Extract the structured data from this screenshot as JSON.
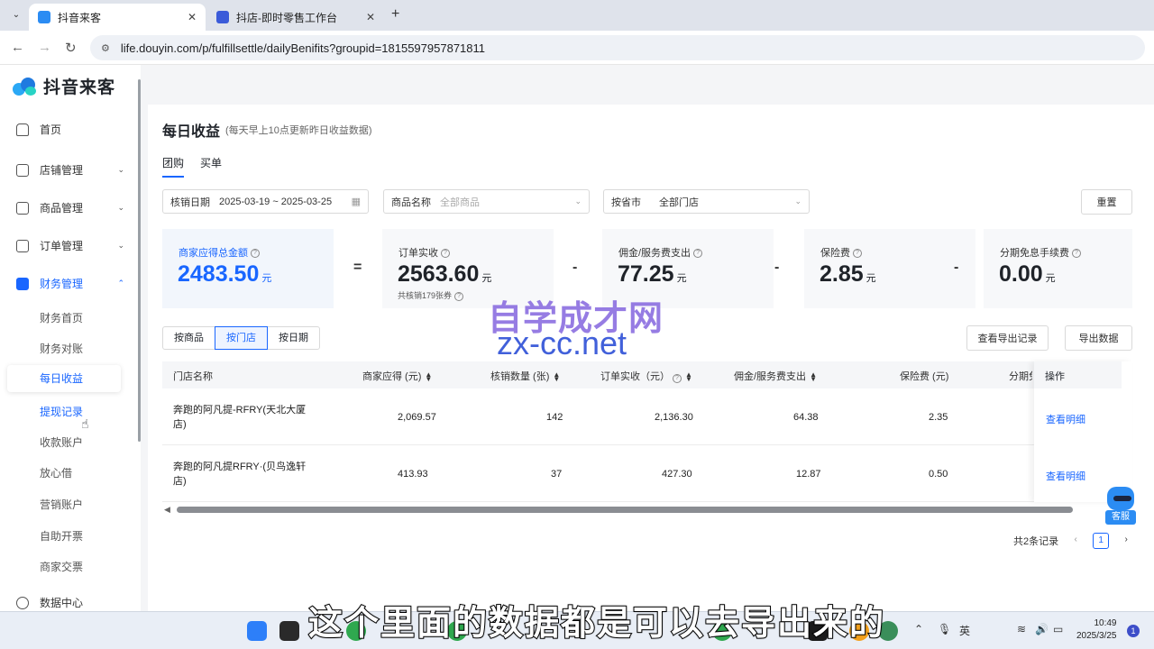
{
  "browser": {
    "tabs": [
      {
        "title": "抖音来客",
        "active": true
      },
      {
        "title": "抖店-即时零售工作台",
        "active": false
      }
    ],
    "url": "life.douyin.com/p/fulfillsettle/dailyBenifits?groupid=1815597957871811"
  },
  "sidebar": {
    "logo": "抖音来客",
    "items": [
      {
        "label": "首页"
      },
      {
        "label": "店铺管理"
      },
      {
        "label": "商品管理"
      },
      {
        "label": "订单管理"
      },
      {
        "label": "财务管理"
      },
      {
        "label": "数据中心"
      }
    ],
    "sub_items": [
      "财务首页",
      "财务对账",
      "每日收益",
      "提现记录",
      "收款账户",
      "放心借",
      "营销账户",
      "自助开票",
      "商家交票"
    ]
  },
  "page": {
    "title": "每日收益",
    "subtitle": "(每天早上10点更新昨日收益数据)",
    "tabs": [
      "团购",
      "买单"
    ],
    "filters": {
      "date_label": "核销日期",
      "date_value": "2025-03-19 ~ 2025-03-25",
      "product_label": "商品名称",
      "product_placeholder": "全部商品",
      "region_label": "按省市",
      "region_value": "全部门店"
    },
    "reset_button": "重置",
    "stats": [
      {
        "label": "商家应得总金额",
        "value": "2483.50",
        "unit": "元"
      },
      {
        "label": "订单实收",
        "value": "2563.60",
        "unit": "元",
        "note": "共核销179张券"
      },
      {
        "label": "佣金/服务费支出",
        "value": "77.25",
        "unit": "元"
      },
      {
        "label": "保险费",
        "value": "2.85",
        "unit": "元"
      },
      {
        "label": "分期免息手续费",
        "value": "0.00",
        "unit": "元"
      }
    ],
    "operators": [
      "=",
      "-",
      "-",
      "-"
    ],
    "segments": [
      "按商品",
      "按门店",
      "按日期"
    ],
    "export_log_button": "查看导出记录",
    "export_button": "导出数据",
    "table": {
      "headers": [
        "门店名称",
        "商家应得 (元)",
        "核销数量 (张)",
        "订单实收（元）",
        "佣金/服务费支出",
        "保险费 (元)",
        "分期免",
        "操作"
      ],
      "rows": [
        {
          "store": "奔跑的阿凡提-RFRY(天北大厦店)",
          "merchant": "2,069.57",
          "qty": "142",
          "received": "2,136.30",
          "commission": "64.38",
          "insurance": "2.35",
          "action": "查看明细"
        },
        {
          "store": "奔跑的阿凡提RFRY·(贝鸟逸轩店)",
          "merchant": "413.93",
          "qty": "37",
          "received": "427.30",
          "commission": "12.87",
          "insurance": "0.50",
          "action": "查看明细"
        }
      ]
    },
    "pagination": {
      "total": "共2条记录",
      "current": "1"
    },
    "customer_service": "客服"
  },
  "overlay": {
    "watermark_line1": "自学成才网",
    "watermark_line2": "zx-cc.net",
    "caption": "这个里面的数据都是可以去导出来的"
  },
  "taskbar": {
    "time": "10:49",
    "date": "2025/3/25",
    "ime": "英",
    "notifications": "1"
  }
}
